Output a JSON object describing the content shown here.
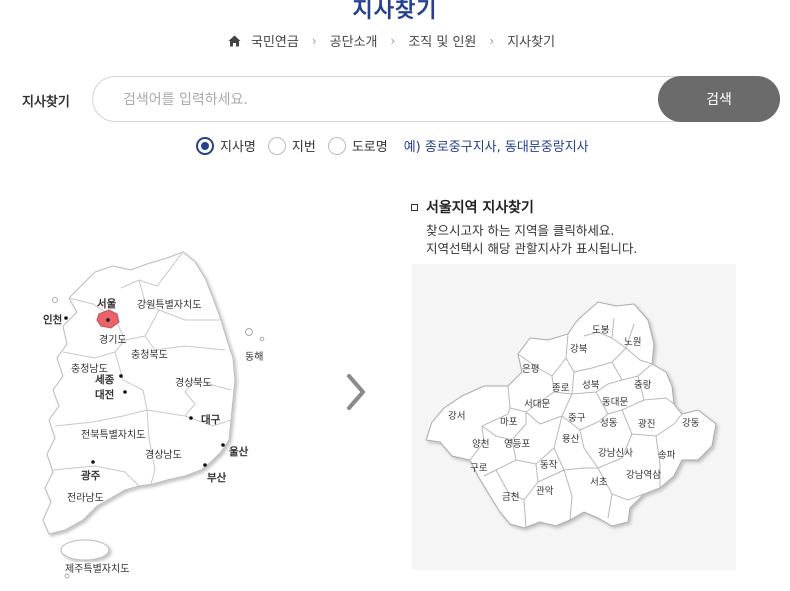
{
  "page_title": "지사찾기",
  "breadcrumb": {
    "items": [
      "국민연금",
      "공단소개",
      "조직 및 인원",
      "지사찾기"
    ]
  },
  "search": {
    "label": "지사찾기",
    "placeholder": "검색어를 입력하세요.",
    "button": "검색"
  },
  "search_type": {
    "options": [
      "지사명",
      "지번",
      "도로명"
    ],
    "selected": "지사명",
    "example": "예) 종로중구지사, 동대문중랑지사"
  },
  "korea_map": {
    "regions": {
      "seoul": "서울",
      "incheon": "인천",
      "gangwon": "강원특별자치도",
      "gyeonggi": "경기도",
      "chungbuk": "충청북도",
      "chungnam": "충청남도",
      "sejong": "세종",
      "daejeon": "대전",
      "gyeongbuk": "경상북도",
      "donghae": "동해",
      "daegu": "대구",
      "jeonbuk": "전북특별자치도",
      "gyeongnam": "경상남도",
      "ulsan": "울산",
      "busan": "부산",
      "gwangju": "광주",
      "jeonnam": "전라남도",
      "jeju": "제주특별자치도"
    },
    "selected": "서울",
    "selected_color": "#e8636b"
  },
  "seoul_section": {
    "title": "서울지역 지사찾기",
    "desc_line1": "찾으시고자 하는 지역을 클릭하세요.",
    "desc_line2": "지역선택시 해당 관할지사가 표시됩니다."
  },
  "seoul_districts": {
    "dobong": "도봉",
    "nowon": "노원",
    "gangbuk": "강북",
    "eunpyeong": "은평",
    "seongbuk": "성북",
    "jungnang": "중랑",
    "jongno": "종로",
    "seodaemun": "서대문",
    "dongdaemun": "동대문",
    "gangseo": "강서",
    "mapo": "마포",
    "junggu": "중구",
    "seongdong": "성동",
    "gwangjin": "광진",
    "gangdong": "강동",
    "yangcheon": "양천",
    "yeongdeungpo": "영등포",
    "yongsan": "용산",
    "gangnamsinsa": "강남신사",
    "songpa": "송파",
    "guro": "구로",
    "dongjak": "동작",
    "gangnamyeoksam": "강남역삼",
    "geumcheon": "금천",
    "gwanak": "관악",
    "seocho": "서초"
  },
  "colors": {
    "accent": "#24408e",
    "button_bg": "#6b6b6b",
    "map_panel_bg": "#f5f5f5"
  }
}
